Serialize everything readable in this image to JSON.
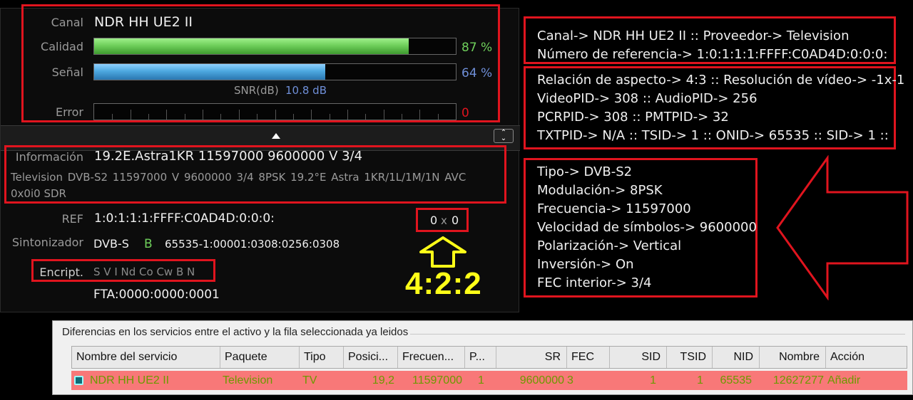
{
  "signal": {
    "canal_label": "Canal",
    "canal_value": "NDR HH UE2 II",
    "calidad_label": "Calidad",
    "calidad_pct": "87 %",
    "calidad_level": 0.87,
    "senal_label": "Señal",
    "senal_pct": "64 %",
    "senal_level": 0.64,
    "snr_label": "SNR(dB)",
    "snr_value": "10.8 dB",
    "error_label": "Error",
    "error_value": "0",
    "calidad_color": "#6fcf5b",
    "senal_color": "#4da8e0"
  },
  "info": {
    "informacion_label": "Información",
    "informacion_value": "19.2E.Astra1KR 11597000 9600000 V 3/4",
    "detail_line1": "Television  DVB-S2  11597000  V  9600000  3/4  8PSK  19.2°E  Astra 1KR/1L/1M/1N  AVC",
    "detail_line2": "0x0i0  SDR",
    "ref_label": "REF",
    "ref_value": "1:0:1:1:1:FFFF:C0AD4D:0:0:0:",
    "res_w": "0",
    "res_x": "x",
    "res_h": "0",
    "sintonizador_label": "Sintonizador",
    "sintonizador_value": "DVB-S",
    "tuner_letter": "B",
    "tuner_pids": "65535-1:00001:0308:0256:0308",
    "encript_label": "Encript.",
    "encript_value": "S V I Nd Co Cw B N",
    "fta_value": "FTA:0000:0000:0001"
  },
  "annotation": {
    "chroma": "4:2:2"
  },
  "right_boxes": {
    "box1": [
      "Canal-> NDR HH UE2 II :: Proveedor-> Television",
      "Número de referencia-> 1:0:1:1:1:FFFF:C0AD4D:0:0:0:"
    ],
    "box2": [
      "Relación de aspecto-> 4:3 :: Resolución de vídeo-> -1x-1",
      "VideoPID-> 308 :: AudioPID-> 256",
      "PCRPID-> 308 :: PMTPID-> 32",
      "TXTPID-> N/A :: TSID-> 1 :: ONID-> 65535 :: SID-> 1 ::"
    ],
    "box3": [
      "Tipo-> DVB-S2",
      "Modulación-> 8PSK",
      "Frecuencia-> 11597000",
      "Velocidad de símbolos-> 9600000",
      "Polarización-> Vertical",
      "Inversión-> On",
      "FEC interior-> 3/4"
    ]
  },
  "table": {
    "group_title": "Diferencias en los servicios entre el activo y la fila seleccionada ya leidos",
    "headers": [
      "Nombre del servicio",
      "Paquete",
      "Tipo",
      "Posici...",
      "Frecuen...",
      "P...",
      "SR",
      "FEC",
      "SID",
      "TSID",
      "NID",
      "Nombre",
      "Acción"
    ],
    "row": [
      "NDR HH UE2 II",
      "Television",
      "TV",
      "19,2",
      "11597000",
      "1",
      "9600000",
      "3",
      "1",
      "1",
      "65535",
      "12627277",
      "Añadir"
    ]
  }
}
